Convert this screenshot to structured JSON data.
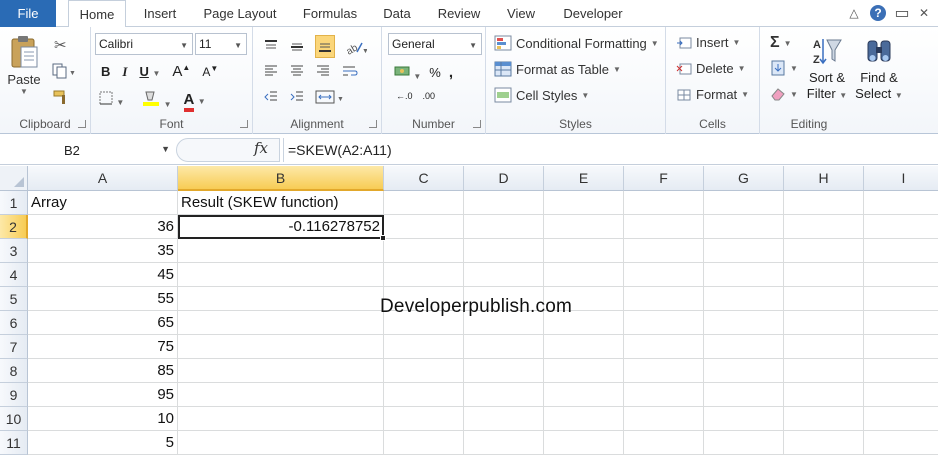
{
  "tabs": {
    "file": "File",
    "items": [
      "Home",
      "Insert",
      "Page Layout",
      "Formulas",
      "Data",
      "Review",
      "View",
      "Developer"
    ],
    "active": "Home"
  },
  "ribbon": {
    "clipboard": {
      "paste": "Paste",
      "label": "Clipboard"
    },
    "font": {
      "name": "Calibri",
      "size": "11",
      "label": "Font",
      "bold": "B",
      "italic": "I",
      "underline": "U",
      "grow": "A",
      "shrink": "A",
      "color_letter": "A"
    },
    "alignment": {
      "label": "Alignment"
    },
    "number": {
      "format": "General",
      "label": "Number",
      "percent": "%",
      "comma": ",",
      "inc_decimal": "←.0",
      "dec_decimal": ".00"
    },
    "styles": {
      "conditional": "Conditional Formatting",
      "format_table": "Format as Table",
      "cell_styles": "Cell Styles",
      "label": "Styles"
    },
    "cells": {
      "insert": "Insert",
      "delete": "Delete",
      "format": "Format",
      "label": "Cells"
    },
    "editing": {
      "autosum": "Σ",
      "sort": "Sort &",
      "filter": "Filter",
      "find": "Find &",
      "select": "Select",
      "label": "Editing"
    }
  },
  "formula_bar": {
    "name_box": "B2",
    "fx": "fx",
    "formula": "=SKEW(A2:A11)"
  },
  "columns": [
    "A",
    "B",
    "C",
    "D",
    "E",
    "F",
    "G",
    "H",
    "I"
  ],
  "rows": [
    "1",
    "2",
    "3",
    "4",
    "5",
    "6",
    "7",
    "8",
    "9",
    "10",
    "11"
  ],
  "cells": {
    "A1": "Array",
    "B1": "Result (SKEW function)",
    "B2": "-0.116278752",
    "A_values": [
      "36",
      "35",
      "45",
      "55",
      "65",
      "75",
      "85",
      "95",
      "10",
      "5"
    ]
  },
  "watermark": "Developerpublish.com",
  "colors": {
    "file_tab": "#2a6bb5",
    "selected_header": "#f7cc55",
    "accent_red": "#e03030"
  }
}
